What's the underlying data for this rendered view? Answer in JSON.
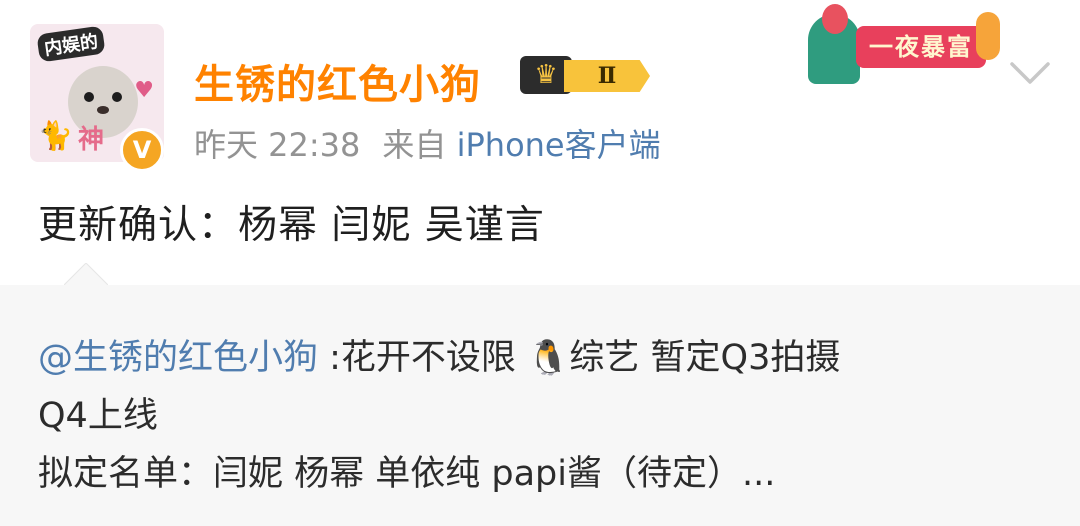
{
  "post": {
    "avatar": {
      "tag_text": "内娱的",
      "heart": "♥",
      "cat": "🐈",
      "word": "神",
      "verified": "V"
    },
    "username": "生锈的红色小狗",
    "vip_badge": {
      "crown": "♛",
      "level": "Ⅱ"
    },
    "festival_badge": {
      "label": "一夜暴富"
    },
    "time": "昨天 22:38",
    "source_prefix": "来自",
    "source_client": "iPhone客户端",
    "text": "更新确认：杨幂 闫妮 吴谨言",
    "menu_icon": "chevron-down-icon"
  },
  "repost": {
    "mention": "@生锈的红色小狗",
    "line1_text": " :花开不设限 ",
    "penguin": "🐧",
    "line1_rest": "综艺 暂定Q3拍摄",
    "line2": "Q4上线",
    "line3": "拟定名单：闫妮 杨幂 单依纯 papi酱（待定）..."
  },
  "colors": {
    "username": "#ff8200",
    "link": "#507daf",
    "meta": "#939393",
    "repost_bg": "#f7f7f7"
  }
}
